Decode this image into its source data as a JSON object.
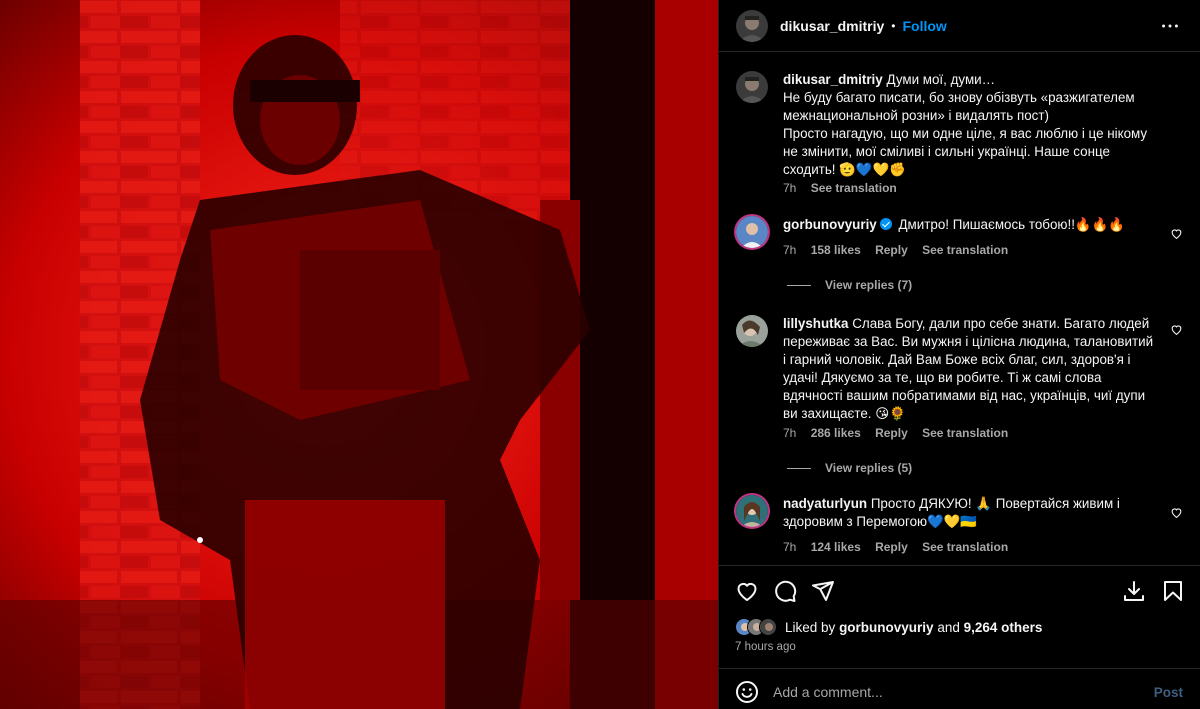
{
  "post": {
    "author": "dikusar_dmitriy",
    "follow_label": "Follow",
    "separator": "•",
    "caption": {
      "author": "dikusar_dmitriy",
      "text": "Думи мої, думи…\nНе буду багато писати, бо знову обізвуть «разжигателем межнациональной розни» і видалять пост)\nПросто нагадую, що ми одне ціле, я вас люблю і це нікому не змінити, мої сміливі і сильні українці. Наше сонце сходить! 🫡💙💛✊",
      "time": "7h",
      "see_translation": "See translation"
    }
  },
  "comments": [
    {
      "author": "gorbunovyuriy",
      "verified": true,
      "text": "Дмитро! Пишаємось тобою!!🔥🔥🔥",
      "time": "7h",
      "likes": "158 likes",
      "reply": "Reply",
      "see_translation": "See translation",
      "view_replies": "View replies (7)"
    },
    {
      "author": "lillyshutka",
      "text": "Слава Богу, дали про себе знати. Багато людей переживає за Вас. Ви мужня і цілісна людина, талановитий і гарний чоловік. Дай Вам Боже всіх благ, сил, здоров'я і удачі! Дякуємо за те, що ви робите. Ті ж самі слова вдячності вашим побратимами від нас, українців, чиї дупи ви захищаєте. 😘🌻",
      "time": "7h",
      "likes": "286 likes",
      "reply": "Reply",
      "see_translation": "See translation",
      "view_replies": "View replies (5)"
    },
    {
      "author": "nadyaturlyun",
      "text": "Просто ДЯКУЮ! 🙏 Повертайся живим і здоровим з Перемогою💙💛🇺🇦",
      "time": "7h",
      "likes": "124 likes",
      "reply": "Reply",
      "see_translation": "See translation"
    }
  ],
  "engagement": {
    "liked_by_prefix": "Liked by",
    "liked_by_user": "gorbunovyuriy",
    "and": "and",
    "others": "9,264 others",
    "time_ago": "7 hours ago"
  },
  "add_comment": {
    "placeholder": "Add a comment...",
    "post_label": "Post"
  },
  "icons": {
    "header_more": "more-horizontal-icon",
    "like": "heart-icon",
    "comment": "comment-icon",
    "share": "share-paper-plane-icon",
    "download": "download-icon",
    "save": "bookmark-icon",
    "emoji": "emoji-icon",
    "comment_like": "heart-icon"
  },
  "colors": {
    "accent": "#0095f6",
    "background": "#000000",
    "muted": "#a8a8a8",
    "photo_tint": "#ff1a1a",
    "post_disabled": "#3e5f7f"
  }
}
